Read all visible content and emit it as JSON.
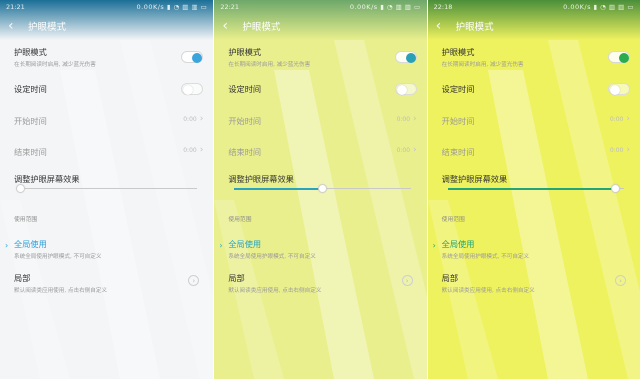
{
  "screens": [
    {
      "status": {
        "time": "21:21",
        "indicators": "0.00K/s ▮ ◔ ▥ ▥ ▭"
      },
      "title": "护眼模式",
      "eye_mode": {
        "label": "护眼模式",
        "desc": "在长期阅读时启用, 减少蓝光伤害",
        "on": true
      },
      "schedule": {
        "label": "设定时间",
        "on": false
      },
      "start": {
        "label": "开始时间",
        "value": "0:00"
      },
      "end": {
        "label": "结束时间",
        "value": "0:00"
      },
      "adjust": {
        "label": "调整护眼屏幕效果",
        "level": 0.0
      },
      "scope_header": "使用范围",
      "global": {
        "label": "全局使用",
        "desc": "系统全局使用护眼模式, 不可自定义"
      },
      "partial": {
        "label": "局部",
        "desc": "默认阅读类应用使用, 点击右侧自定义"
      },
      "colors": {
        "accent": "#2f9fd8",
        "bg_top": "#1a6f97",
        "bg_main": "#f3f5f7",
        "toggle": "#3aa4dc"
      }
    },
    {
      "status": {
        "time": "22:21",
        "indicators": "0.00K/s ▮ ◔ ▥ ▥ ▭"
      },
      "title": "护眼模式",
      "eye_mode": {
        "label": "护眼模式",
        "desc": "在长期阅读时启用, 减少蓝光伤害",
        "on": true
      },
      "schedule": {
        "label": "设定时间",
        "on": false
      },
      "start": {
        "label": "开始时间",
        "value": "0:00"
      },
      "end": {
        "label": "结束时间",
        "value": "0:00"
      },
      "adjust": {
        "label": "调整护眼屏幕效果",
        "level": 0.5
      },
      "scope_header": "使用范围",
      "global": {
        "label": "全局使用",
        "desc": "系统全局使用护眼模式, 不可自定义"
      },
      "partial": {
        "label": "局部",
        "desc": "默认阅读类应用使用, 点击右侧自定义"
      },
      "colors": {
        "accent": "#2aa3c0",
        "bg_top": "#6da86a",
        "bg_main": "#e9ef8c",
        "toggle": "#2aa0b5"
      }
    },
    {
      "status": {
        "time": "22:18",
        "indicators": "0.00K/s ▮ ◔ ▥ ▥ ▭"
      },
      "title": "护眼模式",
      "eye_mode": {
        "label": "护眼模式",
        "desc": "在长期阅读时启用, 减少蓝光伤害",
        "on": true
      },
      "schedule": {
        "label": "设定时间",
        "on": false
      },
      "start": {
        "label": "开始时间",
        "value": "0:00"
      },
      "end": {
        "label": "结束时间",
        "value": "0:00"
      },
      "adjust": {
        "label": "调整护眼屏幕效果",
        "level": 0.95
      },
      "scope_header": "使用范围",
      "global": {
        "label": "全局使用",
        "desc": "系统全局使用护眼模式, 不可自定义"
      },
      "partial": {
        "label": "局部",
        "desc": "默认阅读类应用使用, 点击右侧自定义"
      },
      "colors": {
        "accent": "#23a37a",
        "bg_top": "#4b8f3a",
        "bg_main": "#eef25e",
        "toggle": "#2cab4e"
      }
    }
  ]
}
